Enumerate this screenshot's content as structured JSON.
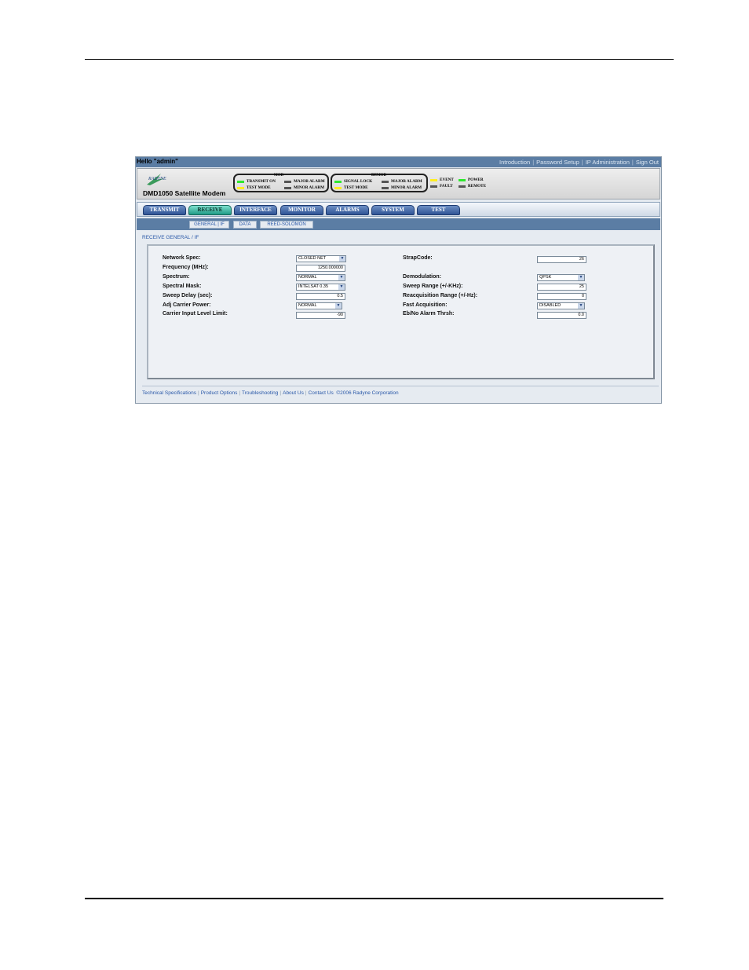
{
  "session": {
    "greeting": "Hello \"admin\"",
    "links": [
      "Introduction",
      "Password Setup",
      "IP Administration",
      "Sign Out"
    ]
  },
  "header": {
    "product": "DMD1050 Satellite Modem",
    "logo_text": "RADYNE",
    "mod_group": {
      "title": "MOD",
      "leds": [
        {
          "label": "TRANSMIT ON",
          "color": "#2ee82e"
        },
        {
          "label": "MAJOR ALARM",
          "color": "#555555"
        },
        {
          "label": "TEST MODE",
          "color": "#ffee22"
        },
        {
          "label": "MINOR ALARM",
          "color": "#555555"
        }
      ]
    },
    "demod_group": {
      "title": "DEMOD",
      "leds": [
        {
          "label": "SIGNAL LOCK",
          "color": "#2ee82e"
        },
        {
          "label": "MAJOR ALARM",
          "color": "#555555"
        },
        {
          "label": "TEST MODE",
          "color": "#ffee22"
        },
        {
          "label": "MINOR ALARM",
          "color": "#555555"
        }
      ]
    },
    "status_leds": [
      {
        "label": "EVENT",
        "color": "#ffee22"
      },
      {
        "label": "POWER",
        "color": "#2ee82e"
      },
      {
        "label": "FAULT",
        "color": "#555555"
      },
      {
        "label": "REMOTE",
        "color": "#555555"
      }
    ]
  },
  "nav": {
    "tabs": [
      "TRANSMIT",
      "RECEIVE",
      "INTERFACE",
      "MONITOR",
      "ALARMS",
      "SYSTEM",
      "TEST"
    ],
    "active_tab": "RECEIVE",
    "subtabs": [
      "GENERAL | IF",
      "DATA",
      "REED-SOLOMON"
    ]
  },
  "section_title": "RECEIVE GENERAL / IF",
  "form": {
    "left": [
      {
        "label": "Network Spec:",
        "value": "CLOSED NET",
        "kind": "select"
      },
      {
        "label": "Frequency (MHz):",
        "value": "1250.000000",
        "kind": "input"
      },
      {
        "label": "Spectrum:",
        "value": "NORMAL",
        "kind": "select"
      },
      {
        "label": "Spectral Mask:",
        "value": "INTELSAT 0.35",
        "kind": "select"
      },
      {
        "label": "Sweep Delay (sec):",
        "value": "0.5",
        "kind": "input"
      },
      {
        "label": "Adj Carrier Power:",
        "value": "NORMAL",
        "kind": "select"
      },
      {
        "label": "Carrier Input Level Limit:",
        "value": "-90",
        "kind": "input"
      }
    ],
    "right": [
      {
        "label": "StrapCode:",
        "value": "26",
        "kind": "input"
      },
      {
        "label": "Demodulation:",
        "value": "QPSK",
        "kind": "select"
      },
      {
        "label": "Sweep Range (+/-KHz):",
        "value": "25",
        "kind": "input"
      },
      {
        "label": "Reacquisition Range (+/-Hz):",
        "value": "0",
        "kind": "input"
      },
      {
        "label": "Fast Acquisition:",
        "value": "DISABLED",
        "kind": "select"
      },
      {
        "label": "Eb/No Alarm Thrsh:",
        "value": "0.0",
        "kind": "input"
      }
    ]
  },
  "footer": {
    "links": [
      "Technical Specifications",
      "Product Options",
      "Troubleshooting",
      "About Us",
      "Contact Us"
    ],
    "copyright": "©2006 Radyne Corporation"
  }
}
